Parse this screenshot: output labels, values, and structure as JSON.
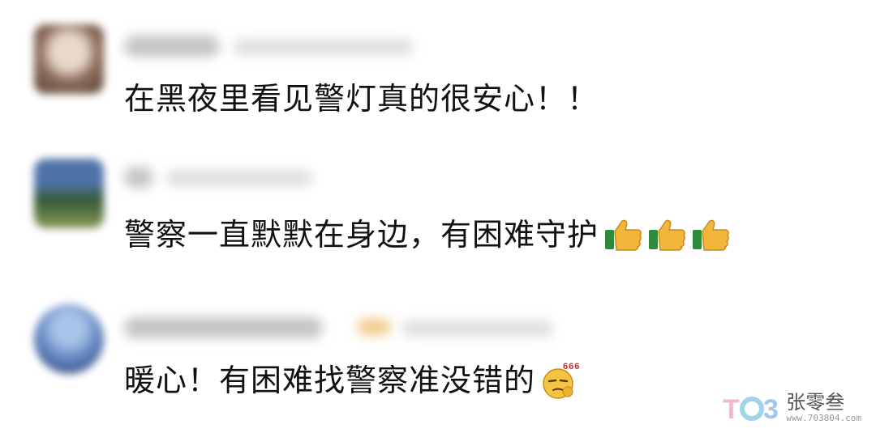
{
  "comments": [
    {
      "text": "在黑夜里看见警灯真的很安心！！",
      "avatar_color": "#b79a86",
      "reaction": null
    },
    {
      "text": "警察一直默默在身边，有困难守护",
      "avatar_color": "#4c6a4a",
      "reaction": "thumbs-up-icon ×3"
    },
    {
      "text": "暖心！有困难找警察准没错的",
      "avatar_color": "#5e7fb8",
      "reaction": "666-thinking-face-icon"
    }
  ],
  "emoji": {
    "label_666": "666"
  },
  "watermark": {
    "name": "张零叁",
    "url": "www.703804.com"
  }
}
